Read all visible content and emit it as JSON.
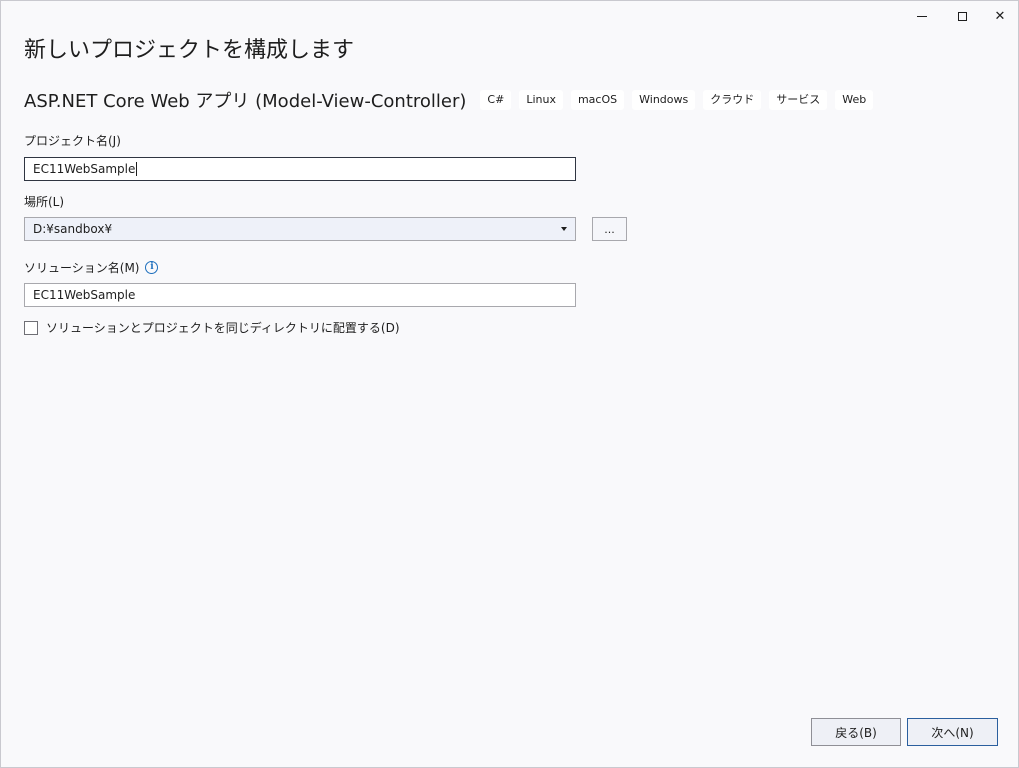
{
  "window": {
    "title": "新しいプロジェクトを構成します",
    "caption": {
      "minimize_icon": "minimize-icon",
      "maximize_icon": "maximize-icon",
      "close_glyph": "✕"
    }
  },
  "template": {
    "name": "ASP.NET Core Web アプリ (Model-View-Controller)",
    "tags": [
      "C#",
      "Linux",
      "macOS",
      "Windows",
      "クラウド",
      "サービス",
      "Web"
    ]
  },
  "project_name": {
    "label": "プロジェクト名(J)",
    "value": "EC11WebSample"
  },
  "location": {
    "label": "場所(L)",
    "value": "D:¥sandbox¥",
    "browse_label": "..."
  },
  "solution_name": {
    "label": "ソリューション名(M)",
    "info_glyph": "i",
    "value": "EC11WebSample"
  },
  "same_directory": {
    "label": "ソリューションとプロジェクトを同じディレクトリに配置する(D)",
    "checked": false
  },
  "footer": {
    "back_label": "戻る(B)",
    "next_label": "次へ(N)"
  },
  "colors": {
    "background": "#f9f9fb",
    "accent_border": "#2b5f9e",
    "info_blue": "#1e6fbd"
  }
}
